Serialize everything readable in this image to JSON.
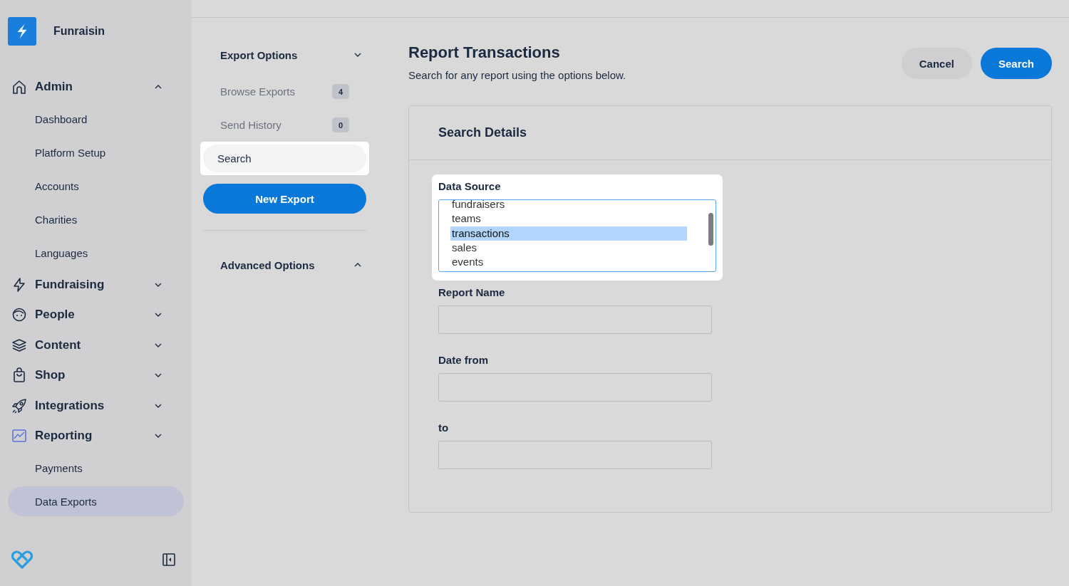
{
  "sidebar": {
    "brand": "Funraisin",
    "sections": [
      {
        "label": "Admin",
        "kind": "home",
        "expanded": true,
        "children": [
          {
            "label": "Dashboard",
            "selected": false
          },
          {
            "label": "Platform Setup",
            "selected": false
          },
          {
            "label": "Accounts",
            "selected": false
          },
          {
            "label": "Charities",
            "selected": false
          },
          {
            "label": "Languages",
            "selected": false
          }
        ]
      },
      {
        "label": "Fundraising",
        "kind": "bolt",
        "expanded": false
      },
      {
        "label": "People",
        "kind": "face",
        "expanded": false
      },
      {
        "label": "Content",
        "kind": "layers",
        "expanded": false
      },
      {
        "label": "Shop",
        "kind": "bag",
        "expanded": false
      },
      {
        "label": "Integrations",
        "kind": "rocket",
        "expanded": false
      },
      {
        "label": "Reporting",
        "kind": "chart",
        "expanded": false,
        "children": [
          {
            "label": "Payments",
            "selected": false
          },
          {
            "label": "Data Exports",
            "selected": true
          }
        ]
      }
    ]
  },
  "export_options": {
    "title": "Export Options",
    "expanded": false,
    "items": [
      {
        "label": "Browse Exports",
        "count": "4",
        "selected": false
      },
      {
        "label": "Send History",
        "count": "0",
        "selected": false
      },
      {
        "label": "Search",
        "selected": true
      }
    ],
    "new_export": "New Export"
  },
  "advanced_options": {
    "title": "Advanced Options",
    "expanded": true
  },
  "header": {
    "title": "Report Transactions",
    "subtitle": "Search for any report using the options below.",
    "buttons": [
      {
        "label": "Cancel",
        "kind": "secondary"
      },
      {
        "label": "Search",
        "kind": "primary"
      }
    ]
  },
  "search_details": {
    "title": "Search Details",
    "fields": [
      {
        "label": "Data Source",
        "kind": "listbox",
        "focused": true,
        "options": [
          {
            "label": "fundraisers",
            "selected": false
          },
          {
            "label": "teams",
            "selected": false
          },
          {
            "label": "transactions",
            "selected": true
          },
          {
            "label": "sales",
            "selected": false
          },
          {
            "label": "events",
            "selected": false
          }
        ]
      },
      {
        "label": "Report Name",
        "kind": "text"
      },
      {
        "label": "Date from",
        "kind": "text"
      },
      {
        "label": "to",
        "kind": "text"
      }
    ]
  }
}
